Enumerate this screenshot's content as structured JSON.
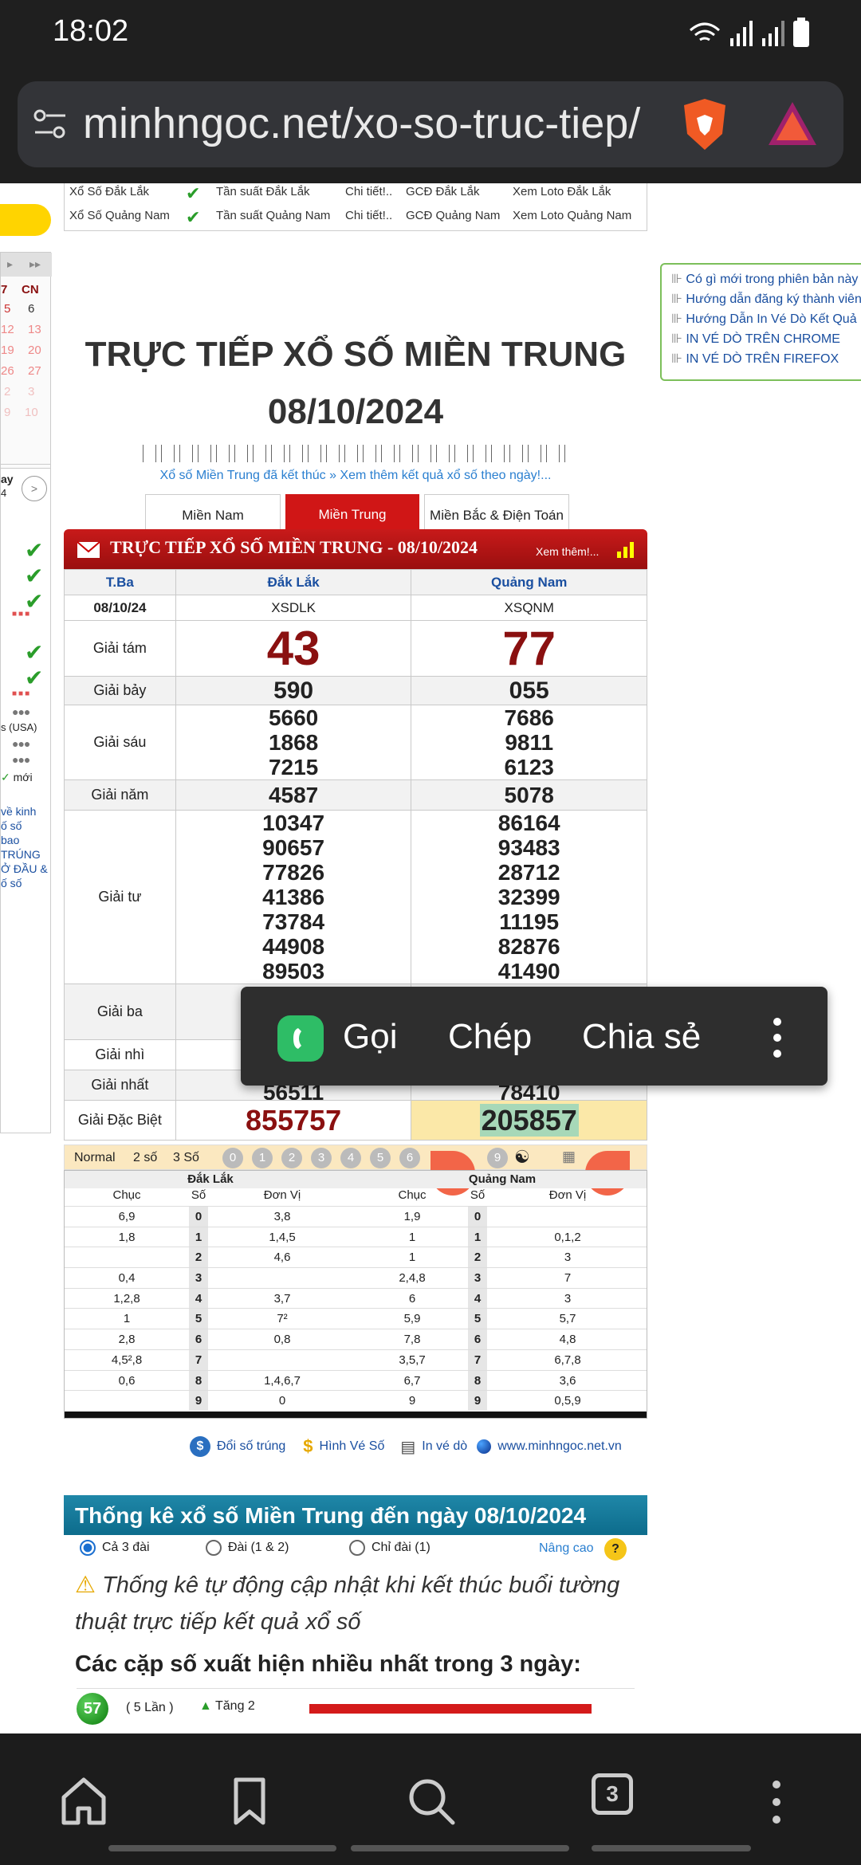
{
  "status": {
    "time": "18:02"
  },
  "browser": {
    "url": "minhngoc.net/xo-so-truc-tiep/",
    "tab_count": "3"
  },
  "top_rows": [
    {
      "c1": "Xổ Số Đắk Lắk",
      "c2": "Tần suất Đắk Lắk",
      "c3": "Chi tiết!..",
      "c4": "GCĐ Đắk Lắk",
      "c5": "Xem Loto Đắk Lắk"
    },
    {
      "c1": "Xổ Số Quảng Nam",
      "c2": "Tần suất Quảng Nam",
      "c3": "Chi tiết!..",
      "c4": "GCĐ Quảng Nam",
      "c5": "Xem Loto Quảng Nam"
    }
  ],
  "left_partial": {
    "cn": "CN",
    "cal7": "7",
    "cal": [
      [
        "5",
        "6"
      ],
      [
        "12",
        "13"
      ],
      [
        "19",
        "20"
      ],
      [
        "26",
        "27"
      ],
      [
        "2",
        "3"
      ],
      [
        "9",
        "10"
      ]
    ],
    "ay": "ay",
    "n4": "4",
    "usa": "s (USA)",
    "moi": "mới",
    "links": [
      "về kinh",
      "ố số",
      "bao",
      "TRÚNG",
      "Ở ĐẦU &",
      "ố số"
    ]
  },
  "right_links": [
    "Có gì mới trong phiên bản này",
    "Hướng dẫn đăng ký thành viên",
    "Hướng Dẫn In Vé Dò Kết Quả",
    "IN VÉ DÒ TRÊN CHROME",
    "IN VÉ DÒ TRÊN FIREFOX"
  ],
  "heading": {
    "line1": "TRỰC TIẾP XỔ SỐ MIỀN TRUNG",
    "line2": "08/10/2024",
    "note": "Xổ số Miền Trung đã kết thúc » Xem thêm kết quả xổ số theo ngày!..."
  },
  "tabs": [
    "Miền Nam",
    "Miền Trung",
    "Miền Bắc & Điện Toán"
  ],
  "banner": {
    "title": "TRỰC TIẾP XỔ SỐ MIỀN TRUNG - 08/10/2024",
    "more": "Xem thêm!..."
  },
  "results": {
    "col_day": "T.Ba",
    "date": "08/10/24",
    "provinces": [
      {
        "name": "Đắk Lắk",
        "code": "XSDLK"
      },
      {
        "name": "Quảng Nam",
        "code": "XSQNM"
      }
    ],
    "rows": [
      {
        "label": "Giải tám",
        "a": [
          "43"
        ],
        "b": [
          "77"
        ]
      },
      {
        "label": "Giải bảy",
        "a": [
          "590"
        ],
        "b": [
          "055"
        ]
      },
      {
        "label": "Giải sáu",
        "a": [
          "5660",
          "1868",
          "7215"
        ],
        "b": [
          "7686",
          "9811",
          "6123"
        ]
      },
      {
        "label": "Giải năm",
        "a": [
          "4587"
        ],
        "b": [
          "5078"
        ]
      },
      {
        "label": "Giải tư",
        "a": [
          "10347",
          "90657",
          "77826",
          "41386",
          "73784",
          "44908",
          "89503"
        ],
        "b": [
          "86164",
          "93483",
          "28712",
          "32399",
          "11195",
          "82876",
          "41490"
        ]
      },
      {
        "label": "Giải ba",
        "a": [
          ""
        ],
        "b": [
          ""
        ]
      },
      {
        "label": "Giải nhì",
        "a": [
          ""
        ],
        "b": [
          ""
        ]
      },
      {
        "label": "Giải nhất",
        "a": [
          "56511"
        ],
        "b": [
          "78410"
        ]
      },
      {
        "label": "Giải Đặc Biệt",
        "a": [
          "855757"
        ],
        "b": [
          "205857"
        ]
      }
    ]
  },
  "popup": {
    "call": "Gọi",
    "copy": "Chép",
    "share": "Chia sẻ"
  },
  "filter": {
    "normal": "Normal",
    "two": "2 số",
    "three": "3 Số",
    "digits": [
      "0",
      "1",
      "2",
      "3",
      "4",
      "5",
      "6",
      "",
      "",
      "9"
    ]
  },
  "loto": {
    "headers": {
      "a": "Đắk Lắk",
      "b": "Quảng Nam",
      "chuc": "Chục",
      "so": "Số",
      "donvi": "Đơn Vị"
    },
    "rows": [
      {
        "ac": "6,9",
        "d": "0",
        "ad": "3,8",
        "bc": "1,9",
        "bd": ""
      },
      {
        "ac": "1,8",
        "d": "1",
        "ad": "1,4,5",
        "bc": "1",
        "bd": "0,1,2"
      },
      {
        "ac": "",
        "d": "2",
        "ad": "4,6",
        "bc": "1",
        "bd": "3"
      },
      {
        "ac": "0,4",
        "d": "3",
        "ad": "",
        "bc": "2,4,8",
        "bd": "7"
      },
      {
        "ac": "1,2,8",
        "d": "4",
        "ad": "3,7",
        "bc": "6",
        "bd": "3"
      },
      {
        "ac": "1",
        "d": "5",
        "ad": "7²",
        "bc": "5,9",
        "bd": "5,7"
      },
      {
        "ac": "2,8",
        "d": "6",
        "ad": "0,8",
        "bc": "7,8",
        "bd": "4,8"
      },
      {
        "ac": "4,5²,8",
        "d": "7",
        "ad": "",
        "bc": "3,5,7",
        "bd": "6,7,8"
      },
      {
        "ac": "0,6",
        "d": "8",
        "ad": "1,4,6,7",
        "bc": "6,7",
        "bd": "3,6"
      },
      {
        "ac": "",
        "d": "9",
        "ad": "0",
        "bc": "9",
        "bd": "0,5,9"
      }
    ]
  },
  "footer_links": [
    "Đổi số trúng",
    "Hình Vé Số",
    "In vé dò",
    "www.minhngoc.net.vn"
  ],
  "stats": {
    "title": "Thống kê xổ số Miền Trung đến ngày 08/10/2024",
    "options": [
      "Cả 3 đài",
      "Đài (1 & 2)",
      "Chỉ đài (1)"
    ],
    "advanced": "Nâng cao",
    "note": "Thống kê tự động cập nhật khi kết thúc buổi tường thuật trực tiếp kết quả xổ số",
    "sub": "Các cặp số xuất hiện nhiều nhất trong 3 ngày:",
    "first": {
      "num": "57",
      "count": "( 5 Lần )",
      "trend": "Tăng 2"
    }
  }
}
